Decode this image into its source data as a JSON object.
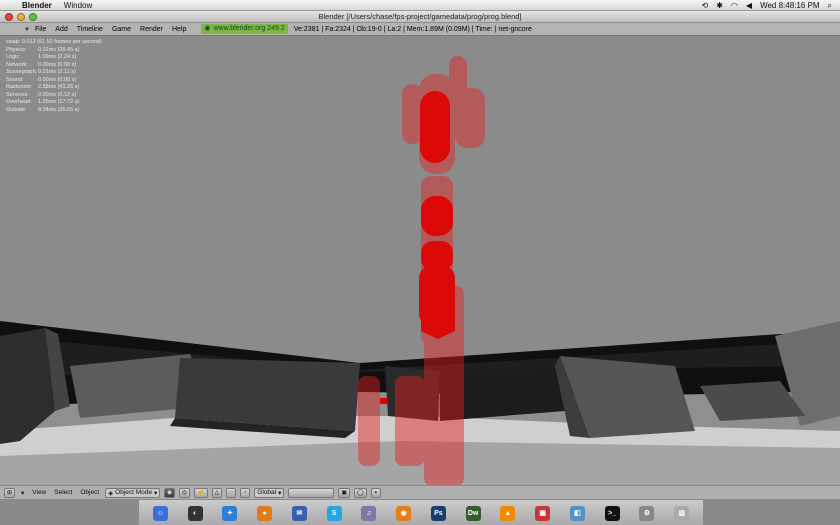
{
  "menubar": {
    "app_name": "Blender",
    "items": [
      "Window"
    ],
    "clock": "Wed 8:48:16 PM"
  },
  "window": {
    "title": "Blender [/Users/chase/fps-project/gamedata/prog/prog.blend]"
  },
  "blender_header": {
    "menus": [
      "File",
      "Add",
      "Timeline",
      "Game",
      "Render",
      "Help"
    ],
    "url": "www.blender.org 249.2",
    "stats": "Ve:2381 | Fa:2324 | Ob:19-0 | La:2  | Mem:1.89M (0.09M)  | Time:  | net-gncore"
  },
  "profile": {
    "header": "swap: 0.013  (61.52 frames per second)",
    "rows": [
      {
        "label": "Physics:",
        "value": "0.02ms (28.45 s)"
      },
      {
        "label": "Logic:",
        "value": "1.99ms (2.24 s)"
      },
      {
        "label": "Network:",
        "value": "0.00ms (0.00 s)"
      },
      {
        "label": "Scenegraph:",
        "value": "0.01ms (2.11 s)"
      },
      {
        "label": "Sound:",
        "value": "0.00ms (0.00 s)"
      },
      {
        "label": "Rasterizer:",
        "value": "2.58ms (41.26 s)"
      },
      {
        "label": "Services:",
        "value": "0.00ms (0.12 s)"
      },
      {
        "label": "Overhead:",
        "value": "1.55ms (17.72 s)"
      },
      {
        "label": "Outside:",
        "value": "8.34ms (26.65 s)"
      }
    ]
  },
  "view3d_header": {
    "menus": [
      "View",
      "Select",
      "Object"
    ],
    "mode": "Object Mode",
    "orientation": "Global"
  },
  "colors": {
    "highlight_red": "#e00000",
    "blender_green": "#7fb83f"
  },
  "dock": {
    "icons": [
      "finder-icon",
      "dashboard-icon",
      "safari-icon",
      "firefox-icon",
      "thunderbird-icon",
      "skype-icon",
      "itunes-icon",
      "blender-icon",
      "photoshop-icon",
      "dreamweaver-icon",
      "vlc-icon",
      "calendar-icon",
      "preview-icon",
      "terminal-icon",
      "system-prefs-icon",
      "trash-icon"
    ]
  }
}
